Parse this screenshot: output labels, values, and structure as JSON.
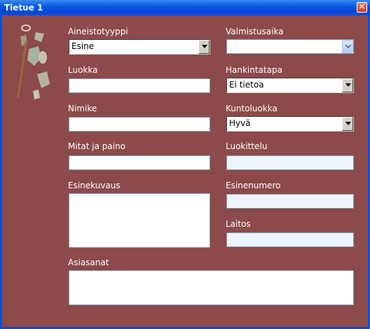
{
  "window": {
    "title": "Tietue  1",
    "close_glyph": "✕"
  },
  "form": {
    "aineistotyyppi": {
      "label": "Aineistotyyppi",
      "value": "Esine"
    },
    "valmistusaika": {
      "label": "Valmistusaika",
      "value": ""
    },
    "luokka": {
      "label": "Luokka",
      "value": ""
    },
    "hankintatapa": {
      "label": "Hankintatapa",
      "value": "Ei tietoa"
    },
    "nimike": {
      "label": "Nimike",
      "value": ""
    },
    "kuntoluokka": {
      "label": "Kuntoluokka",
      "value": "Hyvä"
    },
    "mitat": {
      "label": "Mitat ja paino",
      "value": ""
    },
    "luokittelu": {
      "label": "Luokittelu",
      "value": ""
    },
    "esinekuvaus": {
      "label": "Esinekuvaus",
      "value": ""
    },
    "esinenumero": {
      "label": "Esinenumero",
      "value": ""
    },
    "laitos": {
      "label": "Laitos",
      "value": ""
    },
    "asiasanat": {
      "label": "Asiasanat",
      "value": ""
    }
  },
  "icons": {
    "logo": "artifacts-illustration-icon",
    "dropdown": "chevron-down-icon"
  },
  "colors": {
    "background": "#8c4a4a",
    "titlebar": "#0a5ae0",
    "label": "#ffffff"
  }
}
